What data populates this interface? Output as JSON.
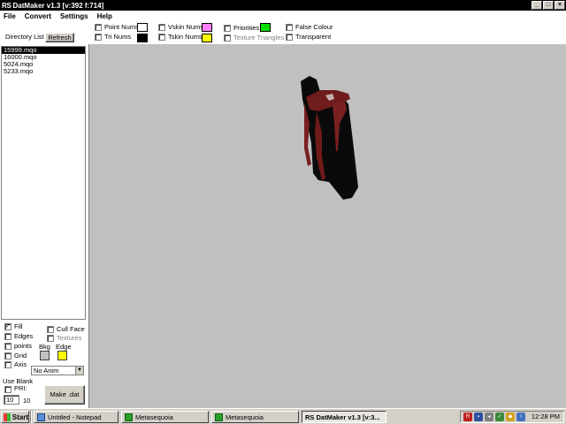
{
  "titlebar": {
    "logo": "RS",
    "title": "DatMaker v1.3  [v:392 f:714]",
    "minimize_icon": "minimize-icon",
    "maximize_icon": "maximize-icon",
    "close_icon": "close-icon"
  },
  "menu": {
    "file": "File",
    "convert": "Convert",
    "settings": "Settings",
    "help": "Help"
  },
  "toolbar": {
    "directory_label": "Directory List",
    "refresh_label": "Refresh",
    "point_nums": "Point Nums",
    "tri_nums": "Tri Nums",
    "vskin_nums": "Vskin Nums",
    "tskin_nums": "Tskin Nums",
    "priorities": "Priorities",
    "texture_triangles": "Texture Triangles",
    "false_colour": "False Colour",
    "transparent": "Transparent",
    "colors": {
      "point_nums": "#ffffff",
      "tri_nums": "#000000",
      "vskin_nums": "#ff80ff",
      "tskin_nums": "#ffff00",
      "priorities": "#00e000"
    }
  },
  "files": [
    {
      "name": "15999.mqo",
      "selected": true
    },
    {
      "name": "16000.mqo",
      "selected": false
    },
    {
      "name": "5024.mqo",
      "selected": false
    },
    {
      "name": "5233.mqo",
      "selected": false
    }
  ],
  "options": {
    "fill": "Fill",
    "fill_checked": "✓",
    "edges": "Edges",
    "points": "points",
    "grid": "Grid",
    "axis": "Axis",
    "cull_face": "Cull Face",
    "textures": "Textures",
    "bkg": "Bkg",
    "edge": "Edge",
    "bkg_color": "#c0c0c0",
    "edge_color": "#ffff00",
    "anim_select": "No Anim",
    "use_blank": "Use Blank",
    "pri": "PRI:",
    "pri_input": "10",
    "pri_value": "10",
    "make_dat": "Make .dat"
  },
  "taskbar": {
    "start": "Start",
    "tasks": [
      {
        "label": "Untitled - Notepad",
        "icon": "notepad-icon"
      },
      {
        "label": "Metasequoia",
        "icon": "metasequoia-icon"
      },
      {
        "label": "Metasequoia",
        "icon": "metasequoia-icon"
      },
      {
        "label": "RS DatMaker v1.3  [v:3...",
        "icon": "datmaker-icon",
        "active": true
      }
    ],
    "clock": "12:28 PM"
  }
}
